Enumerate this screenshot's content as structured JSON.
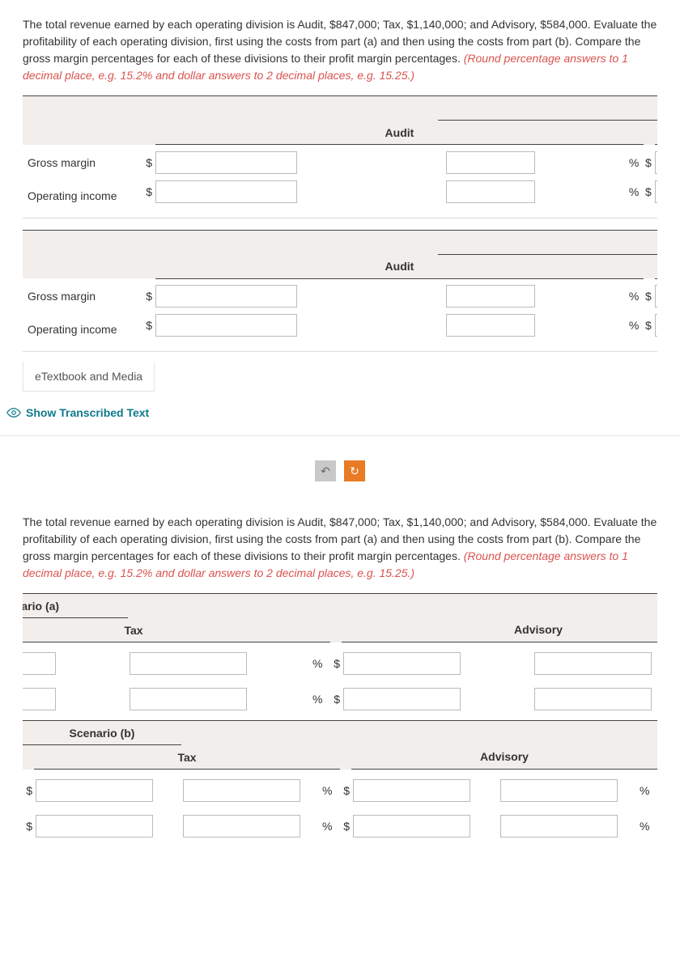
{
  "question": {
    "prefix": "The total revenue earned by each operating division is Audit, $847,000; Tax, $1,140,000; and Advisory, $584,000. Evaluate the profitability of each operating division, first using the costs from part (a) and then using the costs from part (b). Compare the gross margin percentages for each of these divisions to their profit margin percentages. ",
    "hint": "(Round percentage answers to 1 decimal place, e.g. 15.2% and dollar answers to 2 decimal places, e.g. 15.25.)"
  },
  "labels": {
    "scenario_a": "Scenario (a)",
    "scenario_b": "Scenario (b)",
    "audit": "Audit",
    "tax": "Tax",
    "advisory": "Advisory",
    "gross_margin": "Gross margin",
    "operating_income": "Operating income",
    "dollar": "$",
    "percent": "%",
    "etextbook": "eTextbook and Media",
    "show_transcribed": "Show Transcribed Text"
  },
  "icons": {
    "undo": "↶",
    "redo": "↻"
  }
}
